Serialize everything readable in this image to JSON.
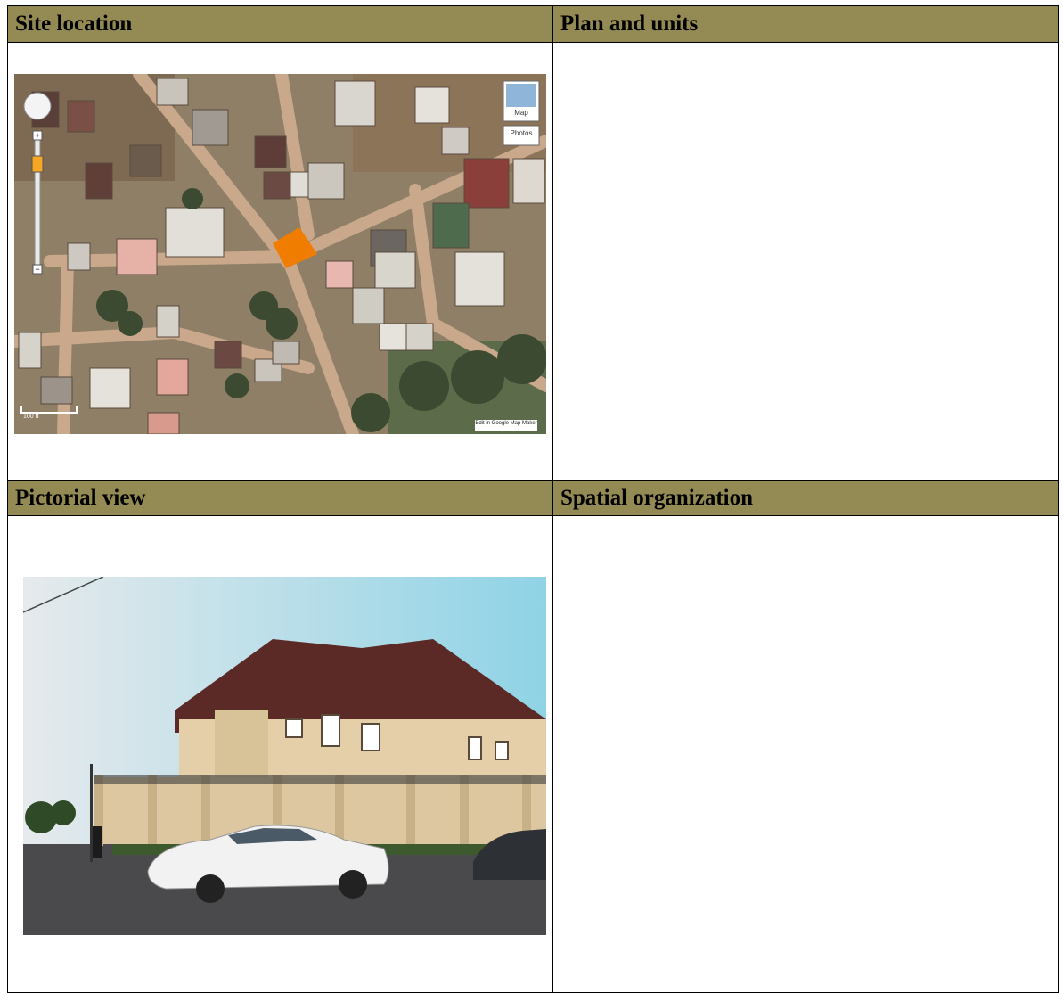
{
  "headers": {
    "site_location": "Site location",
    "plan_and_units": "Plan and units",
    "pictorial_view": "Pictorial view",
    "spatial_organization": "Spatial organization"
  },
  "map": {
    "map_button": "Map",
    "photos_button": "Photos",
    "edit_link": "Edit in Google Map Maker",
    "scale_label": "100 ft",
    "site_color": "#f07c00"
  },
  "colors": {
    "header_bg": "#948a54"
  }
}
